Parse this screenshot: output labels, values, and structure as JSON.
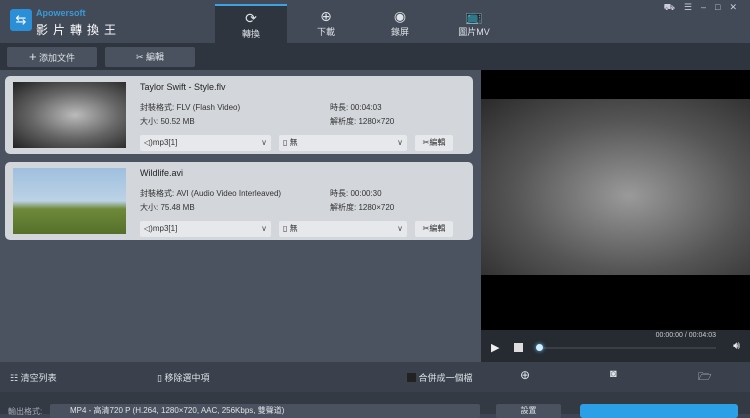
{
  "app": {
    "brand": "Apowersoft",
    "name": "影片轉換王"
  },
  "tabs": [
    {
      "label": "轉換",
      "icon": "refresh-icon"
    },
    {
      "label": "下載",
      "icon": "download-icon"
    },
    {
      "label": "錄屏",
      "icon": "record-icon"
    },
    {
      "label": "圖片MV",
      "icon": "tv-icon"
    }
  ],
  "toolbar": {
    "add": "添加文件",
    "edit": "編輯"
  },
  "files": [
    {
      "name": "Taylor Swift - Style.flv",
      "format": "封裝格式: FLV (Flash Video)",
      "size": "大小: 50.52 MB",
      "duration": "時長: 00:04:03",
      "resolution": "解析度: 1280×720",
      "audio": "mp3[1]",
      "subtitle": "無",
      "edit": "編輯"
    },
    {
      "name": "Wildlife.avi",
      "format": "封裝格式: AVI (Audio Video Interleaved)",
      "size": "大小: 75.48 MB",
      "duration": "時長: 00:00:30",
      "resolution": "解析度: 1280×720",
      "audio": "mp3[1]",
      "subtitle": "無",
      "edit": "編輯"
    }
  ],
  "player": {
    "time": "00:00:00 / 00:04:03",
    "progress": 0
  },
  "bottom": {
    "clear": "清空列表",
    "remove": "移除選中項",
    "merge": "合併成一個檔"
  },
  "output": {
    "label": "輸出格式:",
    "value": "MP4 - 高清720 P (H.264, 1280×720, AAC, 256Kbps, 雙聲道)",
    "settings": "設置"
  }
}
